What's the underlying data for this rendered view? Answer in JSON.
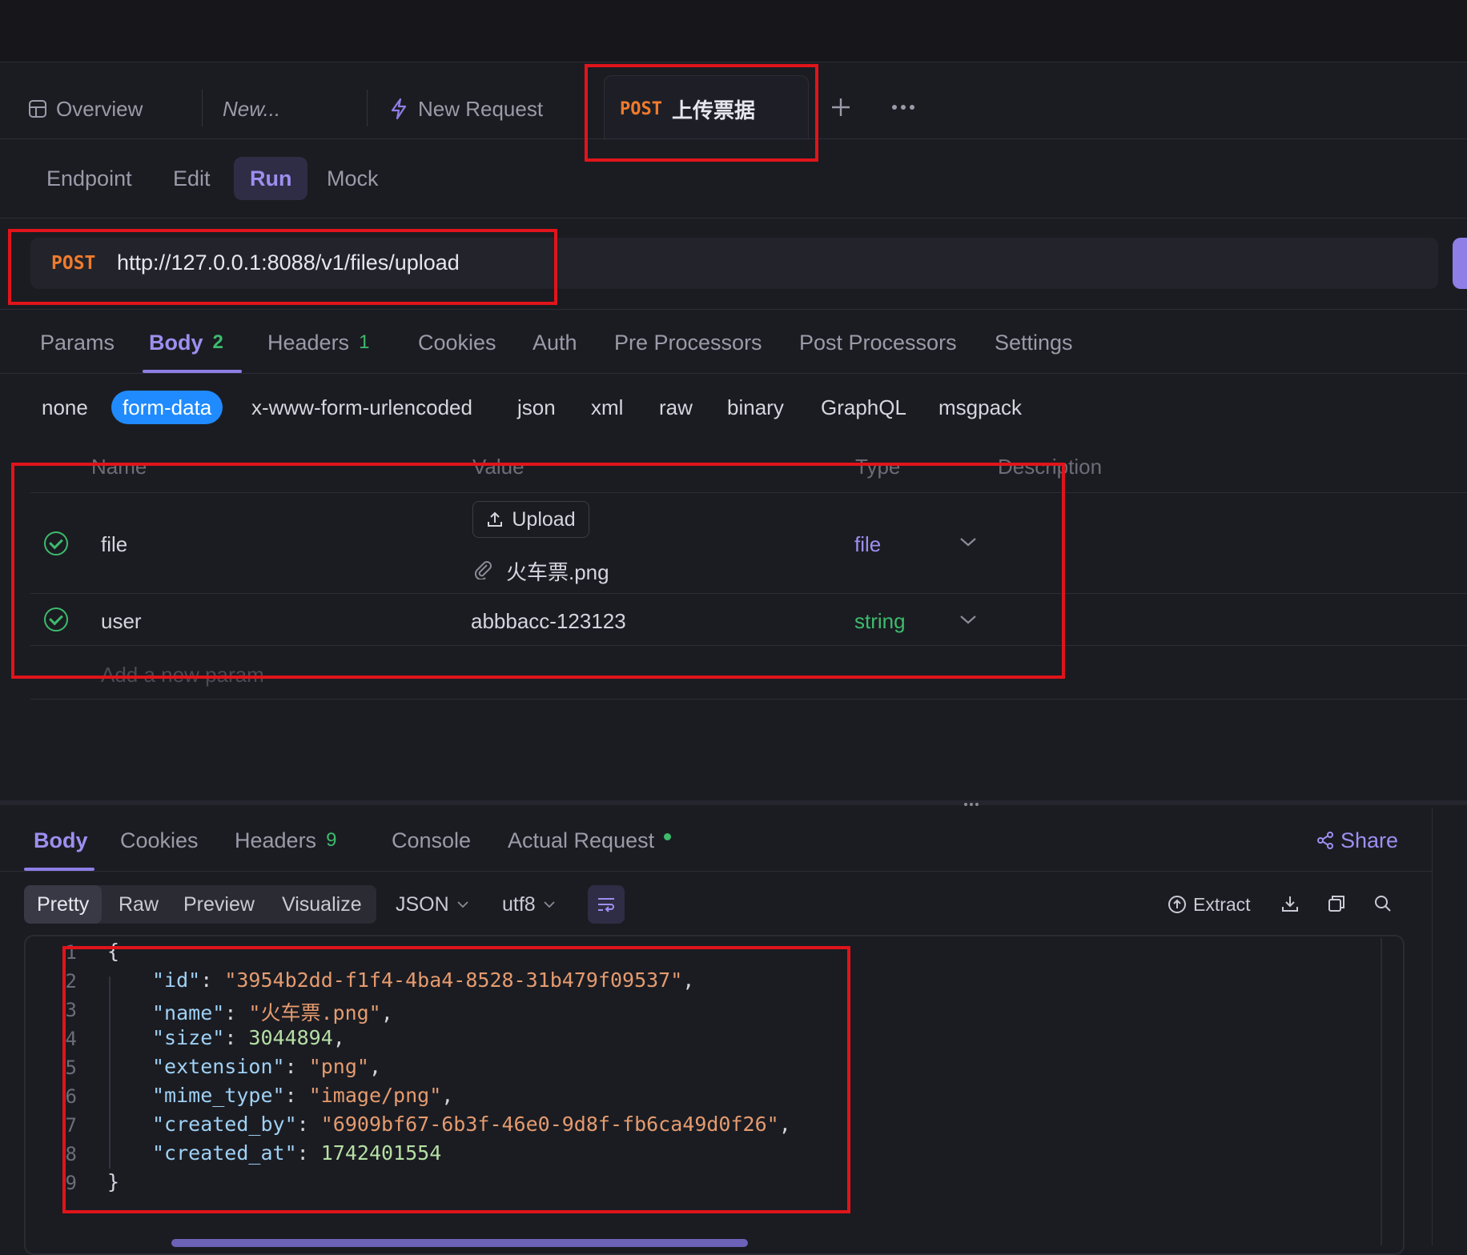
{
  "top_tabs": {
    "overview": "Overview",
    "new": "New...",
    "new_request": "New Request",
    "active_method": "POST",
    "active_title": "上传票据"
  },
  "sub_tabs": [
    "Endpoint",
    "Edit",
    "Run",
    "Mock"
  ],
  "url_bar": {
    "method": "POST",
    "url": "http://127.0.0.1:8088/v1/files/upload"
  },
  "request_tabs": {
    "params": "Params",
    "body": "Body",
    "body_count": "2",
    "headers": "Headers",
    "headers_count": "1",
    "cookies": "Cookies",
    "auth": "Auth",
    "pre": "Pre Processors",
    "post": "Post Processors",
    "settings": "Settings"
  },
  "body_types": [
    "none",
    "form-data",
    "x-www-form-urlencoded",
    "json",
    "xml",
    "raw",
    "binary",
    "GraphQL",
    "msgpack"
  ],
  "params_table": {
    "headers": [
      "Name",
      "Value",
      "Type",
      "Description"
    ],
    "rows": [
      {
        "name": "file",
        "upload_label": "Upload",
        "file_name": "火车票.png",
        "type": "file"
      },
      {
        "name": "user",
        "value": "abbbacc-123123",
        "type": "string"
      }
    ],
    "add_placeholder": "Add a new param"
  },
  "response_tabs": {
    "body": "Body",
    "cookies": "Cookies",
    "headers": "Headers",
    "headers_count": "9",
    "console": "Console",
    "actual_request": "Actual Request",
    "share": "Share"
  },
  "response_toolbar": {
    "views": [
      "Pretty",
      "Raw",
      "Preview",
      "Visualize"
    ],
    "format": "JSON",
    "encoding": "utf8",
    "extract": "Extract"
  },
  "response_body": {
    "line_numbers": [
      "1",
      "2",
      "3",
      "4",
      "5",
      "6",
      "7",
      "8",
      "9"
    ],
    "open_brace": "{",
    "close_brace": "}",
    "fields": [
      {
        "key": "\"id\"",
        "value": "\"3954b2dd-f1f4-4ba4-8528-31b479f09537\"",
        "kind": "s",
        "comma": ","
      },
      {
        "key": "\"name\"",
        "value": "\"火车票.png\"",
        "kind": "s",
        "comma": ","
      },
      {
        "key": "\"size\"",
        "value": "3044894",
        "kind": "n",
        "comma": ","
      },
      {
        "key": "\"extension\"",
        "value": "\"png\"",
        "kind": "s",
        "comma": ","
      },
      {
        "key": "\"mime_type\"",
        "value": "\"image/png\"",
        "kind": "s",
        "comma": ","
      },
      {
        "key": "\"created_by\"",
        "value": "\"6909bf67-6b3f-46e0-9d8f-fb6ca49d0f26\"",
        "kind": "s",
        "comma": ","
      },
      {
        "key": "\"created_at\"",
        "value": "1742401554",
        "kind": "n",
        "comma": ""
      }
    ]
  },
  "colors": {
    "accent": "#9d8ff0",
    "post_method": "#f07b2d",
    "highlight_box": "#e0141a",
    "string_type": "#3dbb6c",
    "file_type": "#9d8ff0",
    "active_body_type": "#1f8bff"
  }
}
